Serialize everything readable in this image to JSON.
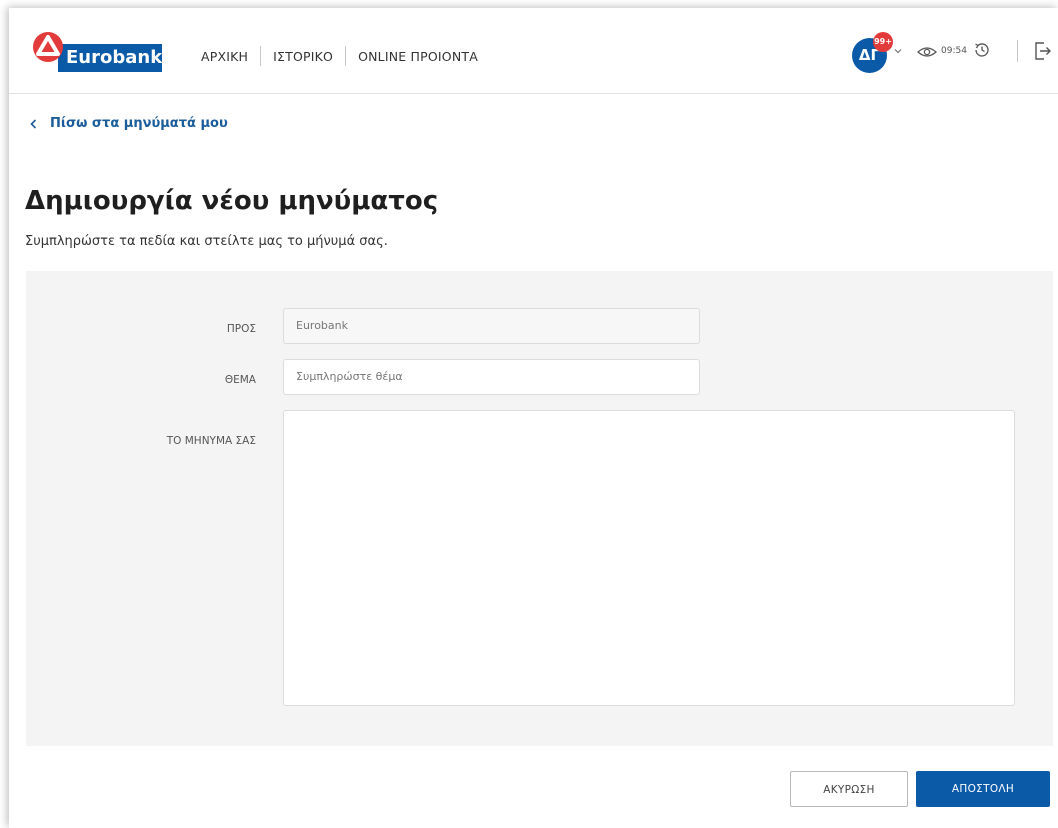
{
  "brand": {
    "name": "Eurobank",
    "primary_color": "#0a5aa8",
    "accent_color": "#e23b3b"
  },
  "nav": {
    "items": [
      "ΑΡΧΙΚΗ",
      "ΙΣΤΟΡΙΚΟ",
      "ONLINE ΠΡΟΙΟΝΤΑ"
    ]
  },
  "user": {
    "initials": "ΔΓ",
    "badge": "99+",
    "time": "09:54"
  },
  "back_link": "Πίσω στα μηνύματά μου",
  "page": {
    "title": "Δημιουργία νέου μηνύματος",
    "subtitle": "Συμπληρώστε τα πεδία και στείλτε μας το μήνυμά σας."
  },
  "form": {
    "to_label": "ΠΡΟΣ",
    "to_value": "Eurobank",
    "subject_label": "ΘΕΜΑ",
    "subject_placeholder": "Συμπληρώστε θέμα",
    "message_label": "ΤΟ ΜΗΝΥΜΑ ΣΑΣ"
  },
  "buttons": {
    "cancel": "ΑΚΥΡΩΣΗ",
    "send": "ΑΠΟΣΤΟΛΗ"
  },
  "icons": [
    "eurobank-logo-icon",
    "chevron-down-icon",
    "eye-icon",
    "clock-icon",
    "logout-icon",
    "chevron-left-icon"
  ]
}
